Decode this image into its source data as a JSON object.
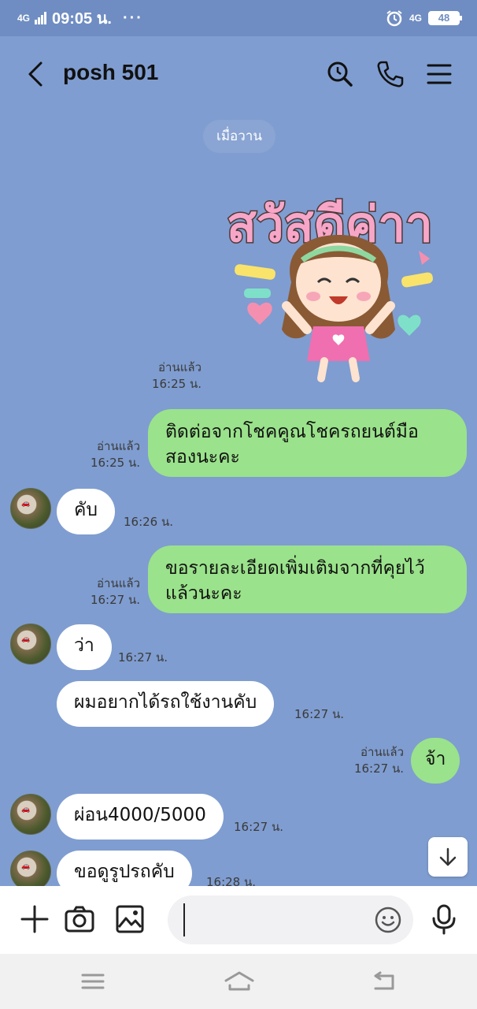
{
  "status_bar": {
    "network_left": "4G",
    "time": "09:05 น.",
    "more": "···",
    "network_right": "4G",
    "battery": "48"
  },
  "header": {
    "title": "posh 501",
    "icons": [
      "back-icon",
      "search-icon",
      "phone-icon",
      "menu-icon"
    ]
  },
  "chat": {
    "date_label": "เมื่อวาน",
    "sticker_text": "สวัสดีค่าา",
    "messages": [
      {
        "from": "me",
        "type": "sticker",
        "read": "อ่านแล้ว",
        "time": "16:25 น."
      },
      {
        "from": "me",
        "text_line1": "ติดต่อจากโชคคูณโชครถยนต์มือ",
        "text_line2": "สองนะคะ",
        "read": "อ่านแล้ว",
        "time": "16:25 น."
      },
      {
        "from": "them",
        "text": "คับ",
        "time": "16:26 น."
      },
      {
        "from": "me",
        "text_line1": "ขอรายละเอียดเพิ่มเติมจากที่คุยไว้",
        "text_line2": "แล้วนะคะ",
        "read": "อ่านแล้ว",
        "time": "16:27 น."
      },
      {
        "from": "them",
        "text": "ว่า",
        "time": "16:27 น."
      },
      {
        "from": "them",
        "text": "ผมอยากได้รถใช้งานคับ",
        "time": "16:27 น."
      },
      {
        "from": "me",
        "text": "จ้า",
        "read": "อ่านแล้ว",
        "time": "16:27 น."
      },
      {
        "from": "them",
        "text": "ผ่อน4000/5000",
        "time": "16:27 น."
      },
      {
        "from": "them",
        "text": "ขอดูรูปรถคับ",
        "time": "16:28 น."
      }
    ]
  },
  "input_bar": {
    "placeholder": "",
    "icons": [
      "plus-icon",
      "camera-icon",
      "image-icon",
      "emoji-icon",
      "mic-icon"
    ]
  },
  "colors": {
    "background": "#7f9dd0",
    "my_bubble": "#9ae28b",
    "their_bubble": "#ffffff",
    "status_bar": "#6f8dc2"
  }
}
